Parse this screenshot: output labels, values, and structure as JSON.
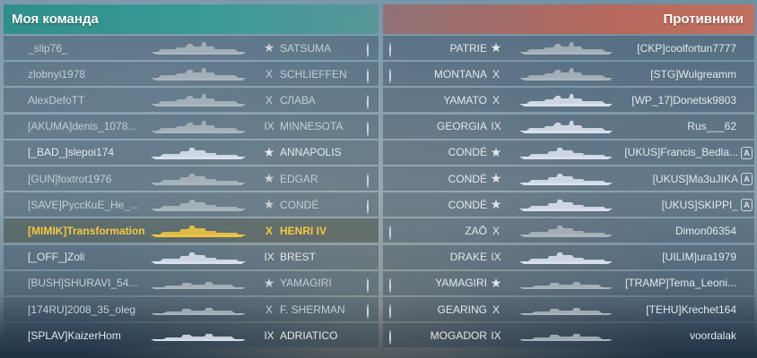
{
  "my_team": {
    "title": "Моя команда",
    "rows": [
      {
        "player": "_slip76_",
        "tier": "★",
        "ship": "SATSUMA",
        "status": "ring",
        "sil": "bb",
        "color": "#aeb8bf",
        "dim": true
      },
      {
        "player": "zlobnyi1978",
        "tier": "X",
        "ship": "SCHLIEFFEN",
        "status": "ring",
        "sil": "bb",
        "color": "#aeb8bf",
        "dim": true
      },
      {
        "player": "AlexDefoTT",
        "tier": "X",
        "ship": "СЛАВА",
        "status": "ring",
        "sil": "bb",
        "color": "#aeb8bf",
        "dim": true
      },
      {
        "player": "[AKUMA]denis_1078...",
        "tier": "IX",
        "ship": "MINNESOTA",
        "status": "ring",
        "sil": "bb",
        "color": "#aeb8bf",
        "dim": true
      },
      {
        "player": "[_BAD_]slepoi174",
        "tier": "★",
        "ship": "ANNAPOLIS",
        "status": "fill",
        "sil": "cr",
        "color": "#dfe6f2",
        "dim": false
      },
      {
        "player": "[GUN]foxtrot1976",
        "tier": "★",
        "ship": "EDGAR",
        "status": "ring",
        "sil": "cr",
        "color": "#aeb8bf",
        "dim": true
      },
      {
        "player": "[SAVE]РуссКuE_He_...",
        "tier": "★",
        "ship": "CONDÉ",
        "status": "ring",
        "sil": "cr",
        "color": "#aeb8bf",
        "dim": true
      },
      {
        "player": "[MIMIK]Transformation",
        "tier": "X",
        "ship": "HENRI IV",
        "status": "fill",
        "sil": "cr",
        "color": "#f5c842",
        "dim": false,
        "highlight": true
      },
      {
        "player": "[_OFF_]Zoli",
        "tier": "IX",
        "ship": "BREST",
        "status": "fill",
        "sil": "cr",
        "color": "#dfe6f2",
        "dim": false
      },
      {
        "player": "[BUSH]SHURAVI_54...",
        "tier": "★",
        "ship": "YAMAGIRI",
        "status": "ring",
        "sil": "dd",
        "color": "#aeb8bf",
        "dim": true
      },
      {
        "player": "[174RU]2008_35_oleg",
        "tier": "X",
        "ship": "F. SHERMAN",
        "status": "ring",
        "sil": "dd",
        "color": "#aeb8bf",
        "dim": true
      },
      {
        "player": "[SPLAV]KaizerHom",
        "tier": "IX",
        "ship": "ADRIATICO",
        "status": "fill",
        "sil": "dd",
        "color": "#dfe6f2",
        "dim": false
      }
    ]
  },
  "enemy_team": {
    "title": "Противники",
    "rows": [
      {
        "player": "[CKP]coolfortun7777",
        "tier": "★",
        "ship": "PATRIE",
        "status": "ring",
        "sil": "bb",
        "color": "#aeb8bf",
        "dim": true
      },
      {
        "player": "[STG]Wulgreamm",
        "tier": "X",
        "ship": "MONTANA",
        "status": "ring",
        "sil": "bb",
        "color": "#aeb8bf",
        "dim": true
      },
      {
        "player": "[WP_17]Donetsk9803",
        "tier": "X",
        "ship": "YAMATO",
        "status": "fill",
        "sil": "bb",
        "color": "#dfe6f2",
        "dim": false
      },
      {
        "player": "Rus___62",
        "tier": "IX",
        "ship": "GEORGIA",
        "status": "fill",
        "sil": "bb",
        "color": "#dfe6f2",
        "dim": false
      },
      {
        "player": "[UKUS]Francis_Bedla...",
        "tier": "★",
        "ship": "CONDÉ",
        "status": "fill",
        "sil": "cr",
        "color": "#dfe6f2",
        "dim": false,
        "badge": "A"
      },
      {
        "player": "[UKUS]Ma3uJIKA",
        "tier": "★",
        "ship": "CONDÉ",
        "status": "fill",
        "sil": "cr",
        "color": "#dfe6f2",
        "dim": false,
        "badge": "A"
      },
      {
        "player": "[UKUS]SKIPPI_",
        "tier": "★",
        "ship": "CONDÉ",
        "status": "fill",
        "sil": "cr",
        "color": "#dfe6f2",
        "dim": false,
        "badge": "A"
      },
      {
        "player": "Dimon06354",
        "tier": "X",
        "ship": "ZAŌ",
        "status": "ring",
        "sil": "cr",
        "color": "#aeb8bf",
        "dim": true
      },
      {
        "player": "[UILIM]ura1979",
        "tier": "IX",
        "ship": "DRAKE",
        "status": "fill",
        "sil": "cr",
        "color": "#dfe6f2",
        "dim": false
      },
      {
        "player": "[TRAMP]Tema_Leoni...",
        "tier": "★",
        "ship": "YAMAGIRI",
        "status": "ring",
        "sil": "dd",
        "color": "#aeb8bf",
        "dim": true
      },
      {
        "player": "[TEHU]Krechet164",
        "tier": "X",
        "ship": "GEARING",
        "status": "ring",
        "sil": "dd",
        "color": "#aeb8bf",
        "dim": true
      },
      {
        "player": "voordalak",
        "tier": "IX",
        "ship": "MOGADOR",
        "status": "ring",
        "sil": "dd",
        "color": "#aeb8bf",
        "dim": true
      }
    ]
  }
}
